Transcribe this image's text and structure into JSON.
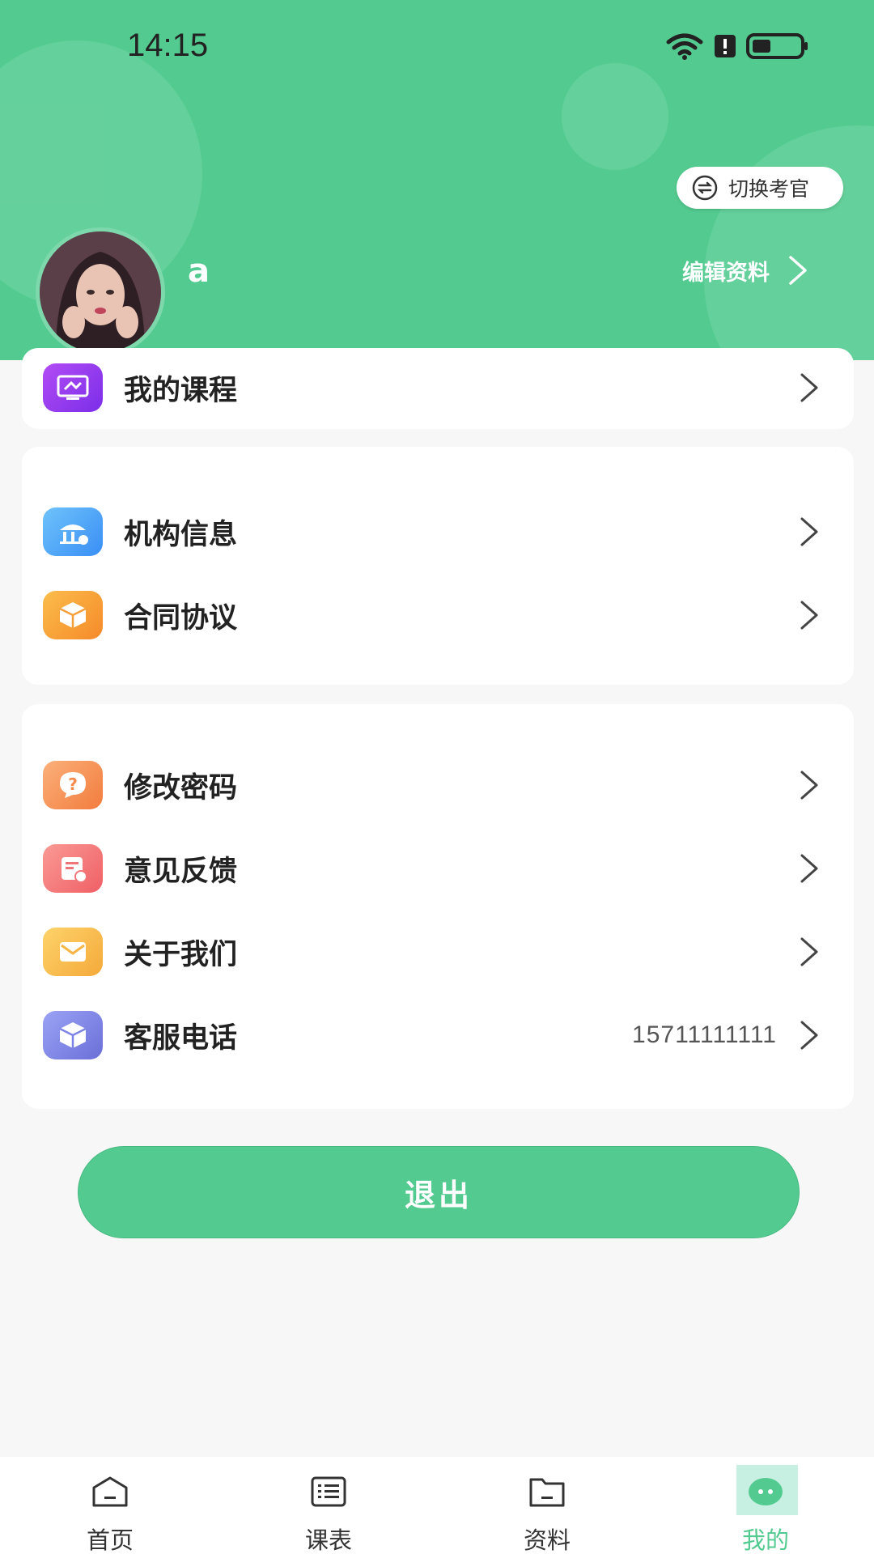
{
  "status_bar": {
    "time": "14:15"
  },
  "header": {
    "switch_button": "切换考官",
    "username": "a",
    "edit_profile": "编辑资料"
  },
  "menu": {
    "my_courses": {
      "label": "我的课程",
      "icon": "course-icon",
      "color": "#9b3cf0"
    },
    "org_info": {
      "label": "机构信息",
      "icon": "institution-icon",
      "color": "#4aa5f7"
    },
    "contract": {
      "label": "合同协议",
      "icon": "box-icon",
      "color": "#f8a23a"
    },
    "change_password": {
      "label": "修改密码",
      "icon": "question-icon",
      "color": "#f69a59"
    },
    "feedback": {
      "label": "意见反馈",
      "icon": "feedback-icon",
      "color": "#f37a7a"
    },
    "about_us": {
      "label": "关于我们",
      "icon": "mail-icon",
      "color": "#f8bf3d"
    },
    "service_phone": {
      "label": "客服电话",
      "icon": "cube-icon",
      "color": "#7d84e6",
      "value": "15711111111"
    }
  },
  "logout_label": "退出",
  "tabs": [
    {
      "label": "首页",
      "icon": "home-icon"
    },
    {
      "label": "课表",
      "icon": "list-icon"
    },
    {
      "label": "资料",
      "icon": "folder-icon"
    },
    {
      "label": "我的",
      "icon": "profile-icon",
      "active": true
    }
  ],
  "colors": {
    "primary": "#53cb90",
    "background": "#f7f7f7"
  }
}
